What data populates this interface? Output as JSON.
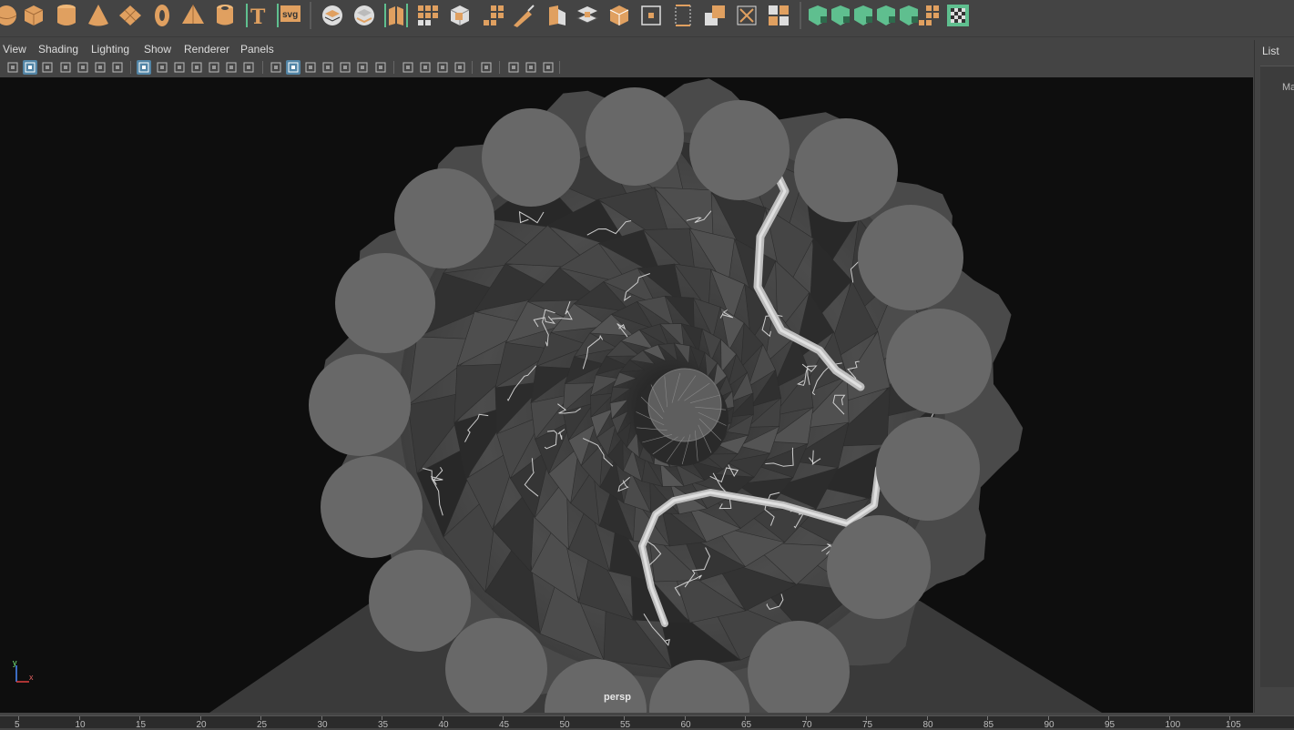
{
  "shelf": {
    "icons": [
      "sphere-icon",
      "cube-icon",
      "cylinder-icon",
      "cone-icon",
      "plane-icon",
      "torus-icon",
      "pyramid-icon",
      "pipe-icon",
      "text-icon",
      "svg-icon",
      "combine-icon",
      "separate-icon",
      "mirror-icon",
      "smooth-icon",
      "bevel-icon",
      "extrude-icon",
      "bridge-icon",
      "multi-cut-icon",
      "target-weld-icon",
      "fill-hole-icon",
      "boolean-icon",
      "insert-edge-loop-icon",
      "offset-edge-icon",
      "merge-icon",
      "uv-editor-icon",
      "extract-icon",
      "green-deformer-1-icon",
      "green-deformer-2-icon",
      "green-deformer-3-icon",
      "green-deformer-4-icon",
      "green-deformer-5-icon",
      "checker-icon",
      "skeleton-icon"
    ],
    "svg_label": "svg",
    "text_label": "T"
  },
  "panel": {
    "menus": [
      "View",
      "Shading",
      "Lighting",
      "Show",
      "Renderer",
      "Panels"
    ]
  },
  "viewport": {
    "camera_label": "persp",
    "axis_y": "y",
    "axis_x": "x"
  },
  "side_panel": {
    "tab_label": "List",
    "label": "Ma"
  },
  "timeline": {
    "labels": [
      "5",
      "10",
      "15",
      "20",
      "25",
      "30",
      "35",
      "40",
      "45",
      "50",
      "55",
      "60",
      "65",
      "70",
      "75",
      "80",
      "85",
      "90",
      "95",
      "100",
      "105"
    ]
  },
  "colors": {
    "accent_orange": "#e0a060",
    "accent_green": "#5fbf8f",
    "active_blue": "#5285a6",
    "viewport_bg": "#0e0e0e"
  }
}
